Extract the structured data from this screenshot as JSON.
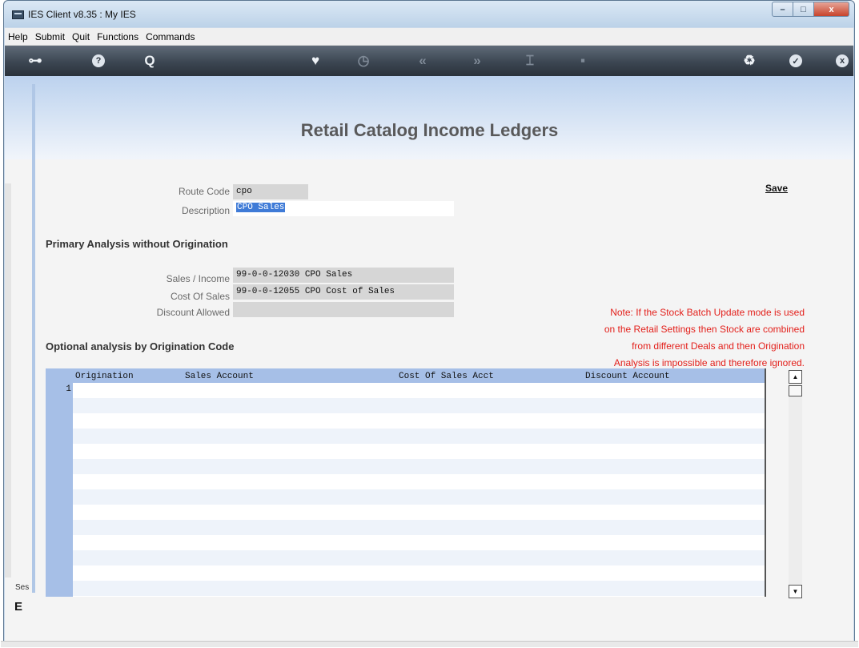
{
  "window": {
    "title": "IES Client v8.35 : My IES",
    "minimize_glyph": "–",
    "maximize_glyph": "□",
    "close_glyph": "x"
  },
  "menu": [
    "Help",
    "Submit",
    "Quit",
    "Functions",
    "Commands"
  ],
  "toolbar": {
    "icons": [
      {
        "name": "key-icon",
        "glyph": "⊶"
      },
      {
        "name": "help-icon",
        "glyph": "?"
      },
      {
        "name": "search-icon",
        "glyph": "Q"
      },
      {
        "name": "heart-icon",
        "glyph": "♥"
      },
      {
        "name": "clock-icon",
        "glyph": "◷"
      },
      {
        "name": "rewind-icon",
        "glyph": "«"
      },
      {
        "name": "forward-icon",
        "glyph": "»"
      },
      {
        "name": "tools-icon",
        "glyph": "⌶"
      },
      {
        "name": "stop-icon",
        "glyph": "▪"
      },
      {
        "name": "recycle-icon",
        "glyph": "♻"
      },
      {
        "name": "check-icon",
        "glyph": "✓"
      },
      {
        "name": "close-icon",
        "glyph": "x"
      }
    ]
  },
  "page": {
    "title": "Retail Catalog Income Ledgers",
    "save_label": "Save"
  },
  "form": {
    "route_code_label": "Route Code",
    "route_code_value": "cpo",
    "description_label": "Description",
    "description_value": "CPO Sales"
  },
  "primary": {
    "heading": "Primary Analysis without Origination",
    "sales_label": "Sales / Income",
    "sales_value": "99-0-0-12030 CPO Sales",
    "cost_label": "Cost Of Sales",
    "cost_value": "99-0-0-12055 CPO Cost of Sales",
    "discount_label": "Discount Allowed",
    "discount_value": ""
  },
  "note": {
    "lines": [
      "Note: If the Stock Batch Update mode is used",
      "on the Retail Settings then Stock are combined",
      "from different Deals and then Origination",
      "Analysis is impossible and therefore ignored."
    ],
    "color": "#e3201b"
  },
  "optional": {
    "heading": "Optional analysis by Origination Code",
    "columns": [
      "Origination",
      "Sales Account",
      "Cost Of Sales Acct",
      "Discount Account"
    ],
    "row_numbers": [
      "1"
    ],
    "row_count": 14
  },
  "status": {
    "ses_label": "Ses",
    "glyph": "E"
  },
  "colors": {
    "selection": "#3f7bd7",
    "grid_header": "#a6bfe7",
    "toolbar": "#3c4652"
  }
}
